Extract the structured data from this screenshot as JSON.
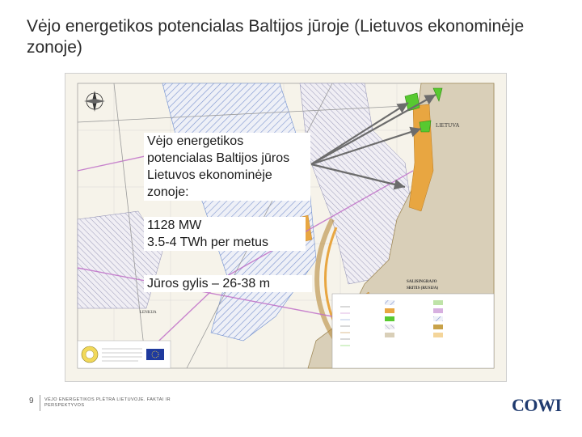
{
  "slide": {
    "title": "Vėjo energetikos potencialas Baltijos jūroje (Lietuvos ekonominėje zonoje)",
    "callout": {
      "heading": "Vėjo energetikos potencialas Baltijos jūros Lietuvos ekonominėje zonoje:",
      "line1": "1128 MW",
      "line2": "3.5-4 TWh per metus",
      "line3": "Jūros gylis – 26-38 m"
    },
    "map_labels": {
      "lithuania": "LIETUVA",
      "kaliningrad_line1": "SALISINGRAJO",
      "kaliningrad_line2": "SRITIS (RUSIJA)",
      "poland": "LENKIJA"
    },
    "footer": {
      "page_number": "9",
      "note": "VĖJO ENERGETIKOS PLĖTRA LIETUVOJE. FAKTAI IR PERSPEKTYVOS"
    },
    "logo": "COWI"
  },
  "colors": {
    "map_land": "#d9cfb8",
    "map_sea": "#f6f3ea",
    "wind_zone_green": "#58c930",
    "orange_zone": "#e8a641",
    "hatch": "#6f8fd0",
    "arrow": "#6c6c6c",
    "logo_blue": "#1f3a6e"
  },
  "icons": [
    "compass-rose-icon",
    "eu-flag-icon",
    "organization-seal-icon"
  ]
}
